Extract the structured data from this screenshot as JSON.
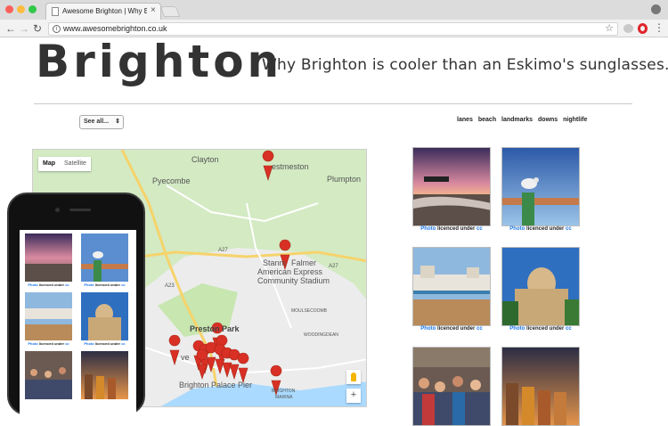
{
  "browser": {
    "tab_title": "Awesome Brighton | Why Brigh",
    "tab_close": "×",
    "url": "www.awesomebrighton.co.uk",
    "back": "←",
    "forward": "→",
    "reload": "↻",
    "info": "i",
    "star": "☆",
    "menu": "⋮"
  },
  "header": {
    "title": "Brighton",
    "tagline": "Why Brighton is cooler than an Eskimo's sunglasses..."
  },
  "controls": {
    "select_value": "See all...",
    "select_arrow": "⇕",
    "filters": [
      "lanes",
      "beach",
      "landmarks",
      "downs",
      "nightlife"
    ]
  },
  "map": {
    "type_map": "Map",
    "type_satellite": "Satellite",
    "zoom_in": "+",
    "labels": {
      "clayton": "Clayton",
      "westmeston": "estmeston",
      "pyecombe": "Pyecombe",
      "plumpton": "Plumpton",
      "stanmer": "Stanm",
      "falmer": "Falmer",
      "amex": "American Express",
      "stadium": "Community Stadium",
      "preston_park": "Preston Park",
      "moulsecoomb": "MOULSECOOMB",
      "woodingdean": "WOODINGDEAN",
      "palace_pier": "Brighton Palace Pier",
      "marina1": "BRIGHTON",
      "marina2": "MARINA",
      "ve": "ve",
      "a27": "A27",
      "a23": "A23"
    }
  },
  "photos": {
    "caption_prefix": "Photo",
    "caption_mid": "licenced under",
    "caption_cc": "cc",
    "items": [
      {
        "subject": "west-pier-sunset"
      },
      {
        "subject": "seagull-lamp"
      },
      {
        "subject": "palace-pier"
      },
      {
        "subject": "royal-pavilion"
      },
      {
        "subject": "lanes-crowd"
      },
      {
        "subject": "beach-huts"
      }
    ]
  },
  "colors": {
    "map_land": "#d3eac3",
    "map_urban": "#ececec",
    "map_sea": "#aadaff",
    "marker": "#d93025",
    "link": "#1a73e8"
  }
}
